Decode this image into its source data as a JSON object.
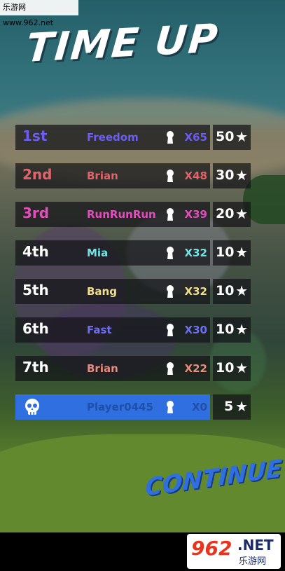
{
  "watermark": {
    "text": "乐游网 www.962.net"
  },
  "title": "TIME UP",
  "rows": [
    {
      "rank": "1st",
      "rank_color": "#6d5cf2",
      "name": "Freedom",
      "name_color": "#6d5cf2",
      "kills": "X65",
      "kills_color": "#6d5cf2",
      "score": "50"
    },
    {
      "rank": "2nd",
      "rank_color": "#e4636b",
      "name": "Brian",
      "name_color": "#e4636b",
      "kills": "X48",
      "kills_color": "#e4636b",
      "score": "30"
    },
    {
      "rank": "3rd",
      "rank_color": "#e34dbd",
      "name": "RunRunRun",
      "name_color": "#e34dbd",
      "kills": "X39",
      "kills_color": "#e34dbd",
      "score": "20"
    },
    {
      "rank": "4th",
      "rank_color": "#ffffff",
      "name": "Mia",
      "name_color": "#6fe5e8",
      "kills": "X32",
      "kills_color": "#6fe5e8",
      "score": "10"
    },
    {
      "rank": "5th",
      "rank_color": "#ffffff",
      "name": "Bang",
      "name_color": "#f1e08a",
      "kills": "X32",
      "kills_color": "#f1e08a",
      "score": "10"
    },
    {
      "rank": "6th",
      "rank_color": "#ffffff",
      "name": "Fast",
      "name_color": "#6d6ff0",
      "kills": "X30",
      "kills_color": "#6d6ff0",
      "score": "10"
    },
    {
      "rank": "7th",
      "rank_color": "#ffffff",
      "name": "Brian",
      "name_color": "#e88a7c",
      "kills": "X22",
      "kills_color": "#e88a7c",
      "score": "10"
    }
  ],
  "player_row": {
    "name": "Player0445",
    "name_color": "#1f4fa8",
    "kills": "X0",
    "kills_color": "#1f4fa8",
    "score": "5",
    "icon": "skull-icon"
  },
  "icons": {
    "kill": "keyhole-icon",
    "star": "star-icon"
  },
  "continue_label": "CONTINUE",
  "logo": {
    "number": "962",
    "net": ".NET",
    "chinese": "乐游网"
  }
}
